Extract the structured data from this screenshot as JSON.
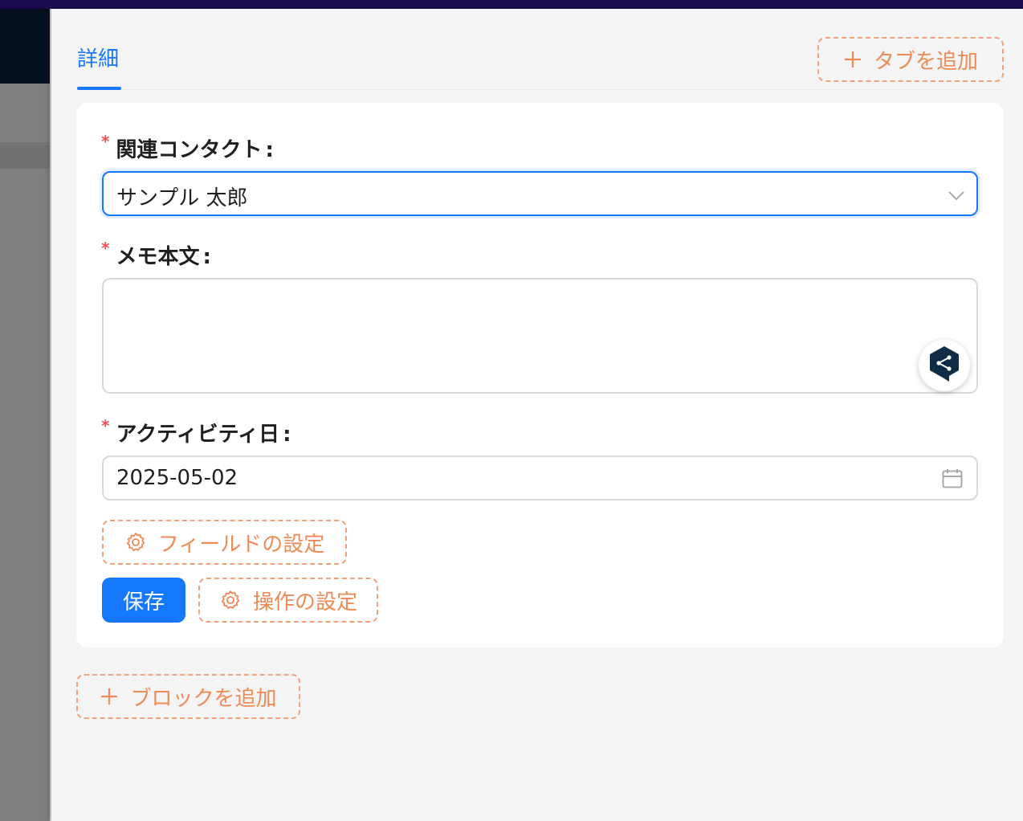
{
  "drawer": {
    "tabs": [
      {
        "label": "詳細",
        "active": true
      }
    ],
    "add_tab_label": "タブを追加",
    "add_block_label": "ブロックを追加"
  },
  "form": {
    "fields": {
      "contact": {
        "label": "関連コンタクト",
        "value": "サンプル 太郎",
        "required": true
      },
      "memo": {
        "label": "メモ本文",
        "value": "",
        "required": true
      },
      "activity_date": {
        "label": "アクティビティ日",
        "value": "2025-05-02",
        "required": true
      }
    },
    "label_suffix": ":",
    "required_mark": "*",
    "field_settings_label": "フィールドの設定",
    "save_label": "保存",
    "action_settings_label": "操作の設定"
  },
  "icons": {
    "plus": "plus-icon",
    "gear": "gear-icon",
    "chevron": "chevron-down-icon",
    "calendar": "calendar-icon",
    "assistant": "assistant-bubble-icon"
  },
  "colors": {
    "primary": "#1677ff",
    "dashed_accent": "#ee8a55",
    "required": "#ff4d4f",
    "background": "#f4f4f4"
  }
}
